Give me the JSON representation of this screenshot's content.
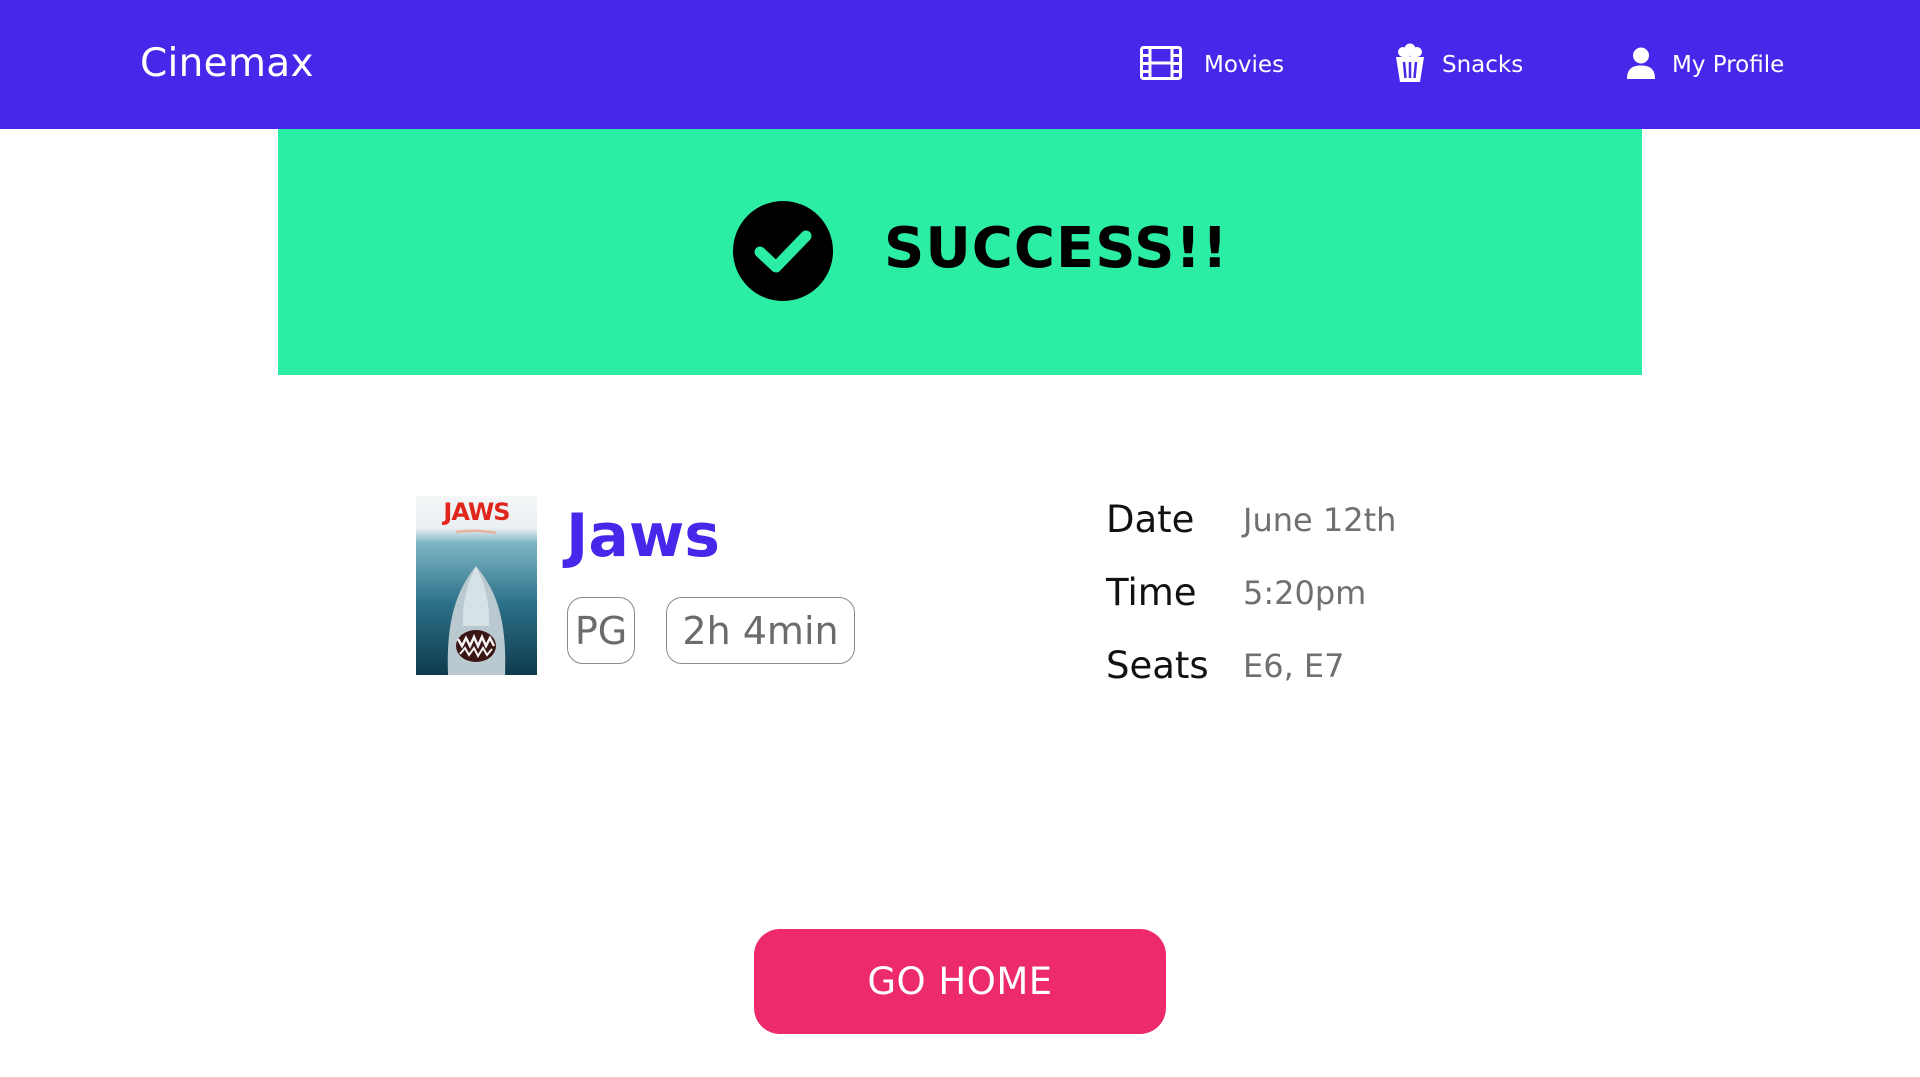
{
  "header": {
    "brand": "Cinemax",
    "nav": [
      {
        "label": "Movies",
        "icon": "film-icon"
      },
      {
        "label": "Snacks",
        "icon": "popcorn-icon"
      },
      {
        "label": "My Profile",
        "icon": "user-icon"
      }
    ]
  },
  "banner": {
    "message": "SUCCESS!!",
    "icon": "check-circle-icon"
  },
  "movie": {
    "title": "Jaws",
    "poster_title": "JAWS",
    "rating": "PG",
    "duration": "2h 4min"
  },
  "details": {
    "date_label": "Date",
    "date_value": "June 12th",
    "time_label": "Time",
    "time_value": "5:20pm",
    "seats_label": "Seats",
    "seats_value": "E6, E7"
  },
  "actions": {
    "home_label": "GO HOME"
  },
  "colors": {
    "header_bg": "#4528EA",
    "banner_bg": "#2CEDA4",
    "accent": "#4528EA",
    "button_bg": "#EC2A6C"
  }
}
